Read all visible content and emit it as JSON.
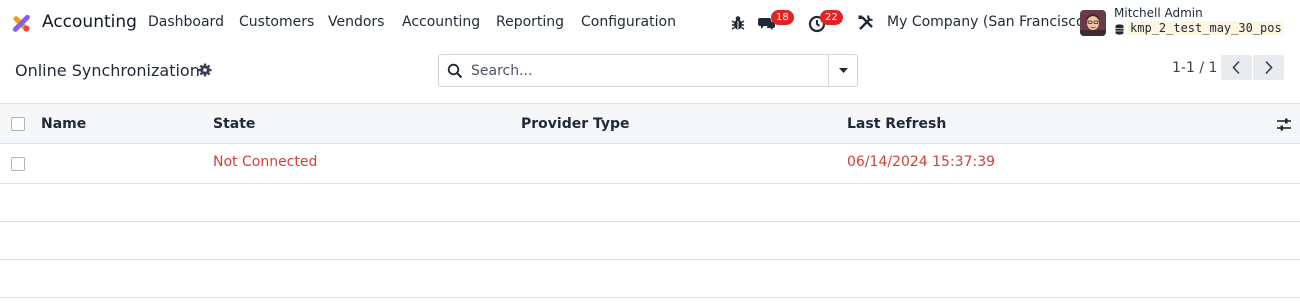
{
  "navbar": {
    "app_name": "Accounting",
    "menu": [
      "Dashboard",
      "Customers",
      "Vendors",
      "Accounting",
      "Reporting",
      "Configuration"
    ],
    "messages_count": "18",
    "activities_count": "22",
    "company": "My Company (San Francisco)",
    "user_name": "Mitchell Admin",
    "database": "kmp_2_test_may_30_pos",
    "icons": {
      "debug": "bug-icon",
      "messages": "chat-icon",
      "activities": "clock-icon",
      "company": "tools-icon",
      "database": "database-icon"
    },
    "badge_color": "#e02424"
  },
  "control_panel": {
    "title": "Online Synchronization",
    "search_placeholder": "Search...",
    "pager": "1-1 / 1"
  },
  "list": {
    "columns": [
      "Name",
      "State",
      "Provider Type",
      "Last Refresh"
    ],
    "rows": [
      {
        "name": "",
        "state": "Not Connected",
        "provider_type": "",
        "last_refresh": "06/14/2024 15:37:39"
      }
    ]
  },
  "colors": {
    "danger_text": "#d23f3a",
    "header_background": "#f6f7f9",
    "border": "#dee2e6"
  }
}
